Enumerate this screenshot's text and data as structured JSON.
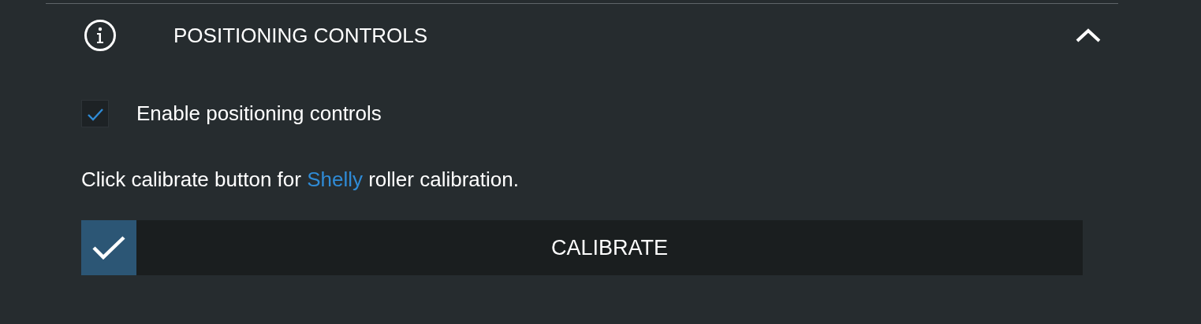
{
  "section": {
    "title": "POSITIONING CONTROLS",
    "expanded": true
  },
  "enable_option": {
    "label": "Enable positioning controls",
    "checked": true
  },
  "calibration_note": {
    "before": "Click calibrate button for ",
    "link": "Shelly",
    "after": " roller calibration."
  },
  "calibrate_button": {
    "label": "CALIBRATE"
  }
}
